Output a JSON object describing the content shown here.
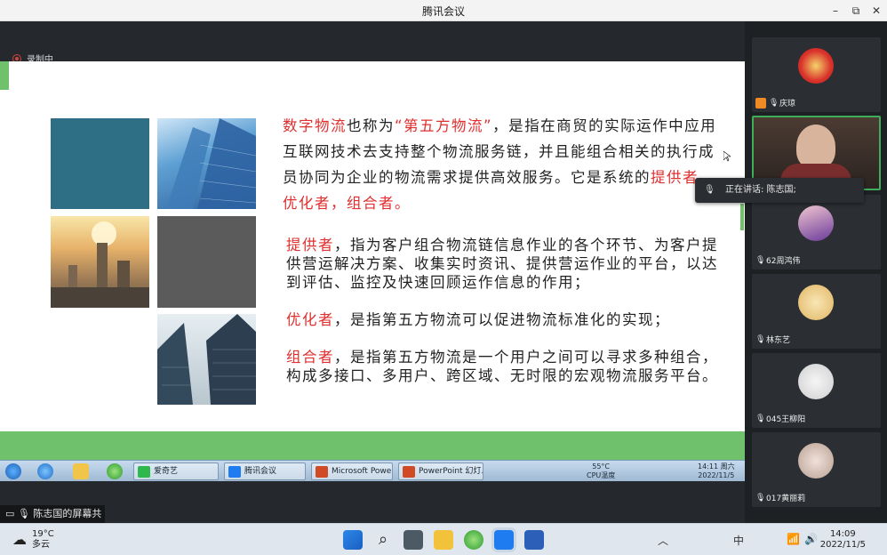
{
  "window": {
    "title": "腾讯会议",
    "minimize": "–",
    "maximize": "⧉",
    "close": "✕"
  },
  "recording": {
    "label": "录制中"
  },
  "slide": {
    "p1_red1": "数字物流",
    "p1_t1": "也称为",
    "p1_red2": "“第五方物流”",
    "p1_t2": "，是指在商贸的实际运作中应用互联网技术去支持整个物流服务链，并且能组合相关的执行成员协同为企业的物流需求提供高效服务。它是系统的",
    "p1_red3": "提供者，优化者，组合者。",
    "p2_red": "提供者",
    "p2_t": "，指为客户组合物流链信息作业的各个环节、为客户提供营运解决方案、收集实时资讯、提供营运作业的平台，以达到评估、监控及快速回顾运作信息的作用；",
    "p3_red": "优化者",
    "p3_t": "，是指第五方物流可以促进物流标准化的实现；",
    "p4_red": "组合者",
    "p4_t": "，是指第五方物流是一个用户之间可以寻求多种组合，构成多接口、多用户、跨区域、无时限的宏观物流服务平台。"
  },
  "inner_taskbar": {
    "items": [
      {
        "label": "爱奇艺",
        "color": "#2fb84d"
      },
      {
        "label": "腾讯会议",
        "color": "#1e7bf0"
      },
      {
        "label": "Microsoft Powe...",
        "color": "#d04a26"
      },
      {
        "label": "PowerPoint 幻灯...",
        "color": "#d04a26"
      }
    ],
    "temp": "55°C",
    "temp_label": "CPU温度",
    "time": "14:11 周六",
    "date": "2022/11/5"
  },
  "share_bar": {
    "label": "陈志国的屏幕共享"
  },
  "speaking": {
    "label": "正在讲话: 陈志国;"
  },
  "participants": [
    {
      "name": "庆琼"
    },
    {
      "name": ""
    },
    {
      "name": "62周鸿伟"
    },
    {
      "name": "林东艺"
    },
    {
      "name": "045王柳阳"
    },
    {
      "name": "017黄丽莉"
    }
  ],
  "taskbar": {
    "weather_temp": "19°C",
    "weather_desc": "多云",
    "time": "14:09",
    "date": "2022/11/5",
    "ime": "中"
  }
}
